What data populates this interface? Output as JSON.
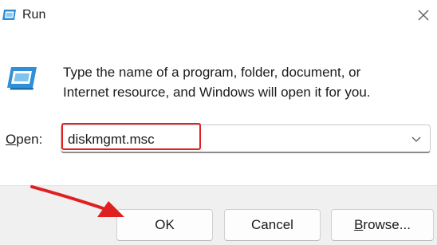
{
  "window": {
    "title": "Run"
  },
  "dialog": {
    "description_line1": "Type the name of a program, folder, document, or",
    "description_line2": "Internet resource, and Windows will open it for you.",
    "open_label_accel": "O",
    "open_label_rest": "pen:",
    "open_value": "diskmgmt.msc"
  },
  "buttons": {
    "ok": "OK",
    "cancel": "Cancel",
    "browse_accel": "B",
    "browse_rest": "rowse..."
  },
  "icons": {
    "app": "run-icon",
    "close": "close-icon",
    "dropdown": "chevron-down-icon"
  },
  "colors": {
    "annotation": "#e02020",
    "icon_blue": "#2f8fd8"
  }
}
